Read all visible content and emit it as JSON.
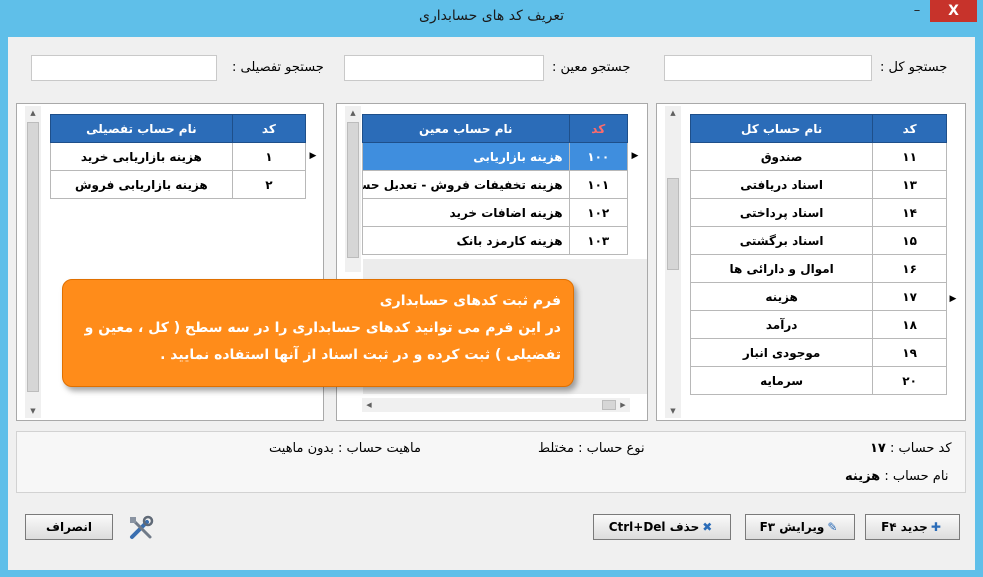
{
  "window": {
    "title": "تعریف کد های حسابداری",
    "minimize": "–",
    "close": "X"
  },
  "search": {
    "general_label": "جستجو کل :",
    "moein_label": "جستجو معین :",
    "tafsili_label": "جستجو تفصیلی :",
    "general_value": "",
    "moein_value": "",
    "tafsili_value": ""
  },
  "general_grid": {
    "headers": {
      "code": "کد",
      "name": "نام حساب کل"
    },
    "rows": [
      {
        "code": "۱۱",
        "name": "صندوق"
      },
      {
        "code": "۱۳",
        "name": "اسناد دریافتی"
      },
      {
        "code": "۱۴",
        "name": "اسناد پرداختی"
      },
      {
        "code": "۱۵",
        "name": "اسناد برگشتی"
      },
      {
        "code": "۱۶",
        "name": "اموال و دارائی ها"
      },
      {
        "code": "۱۷",
        "name": "هزینه"
      },
      {
        "code": "۱۸",
        "name": "درآمد"
      },
      {
        "code": "۱۹",
        "name": "موجودی انبار"
      },
      {
        "code": "۲۰",
        "name": "سرمایه"
      }
    ]
  },
  "moein_grid": {
    "headers": {
      "code": "کد",
      "name": "نام حساب معین"
    },
    "rows": [
      {
        "code": "۱۰۰",
        "name": "هزینه بازاریابی"
      },
      {
        "code": "۱۰۱",
        "name": "هزینه تخفیفات فروش - تعدیل حسا"
      },
      {
        "code": "۱۰۲",
        "name": "هزینه اضافات خرید"
      },
      {
        "code": "۱۰۳",
        "name": "هزینه کارمزد بانک"
      }
    ]
  },
  "tafsili_grid": {
    "headers": {
      "code": "کد",
      "name": "نام حساب تفصیلی"
    },
    "rows": [
      {
        "code": "۱",
        "name": "هزینه بازاریابی خرید"
      },
      {
        "code": "۲",
        "name": "هزینه بازاریابی فروش"
      }
    ]
  },
  "tooltip": {
    "title": "فرم ثبت کدهای حسابداری",
    "line1": "در این فرم می توانید کدهای حسابداری را در سه سطح ( کل ، معین و",
    "line2": "تفضیلی ) ثبت کرده و در ثبت اسناد از آنها استفاده نمایید ."
  },
  "details": {
    "code_label": "کد حساب :",
    "code_value": "۱۷",
    "name_label": "نام حساب :",
    "name_value": "هزینه",
    "type_label": "نوع حساب :",
    "type_value": "مختلط",
    "nature_label": "ماهیت حساب :",
    "nature_value": "بدون ماهیت"
  },
  "buttons": {
    "new": "جدید F۴",
    "edit": "ویرایش F۳",
    "delete": "حذف Ctrl+Del",
    "cancel": "انصراف"
  },
  "colors": {
    "title_bar": "#5fbfe9",
    "grid_header": "#2b6cb8",
    "selected_row": "#3f8ede",
    "tooltip": "#ff8c1a",
    "close": "#c7332b"
  }
}
